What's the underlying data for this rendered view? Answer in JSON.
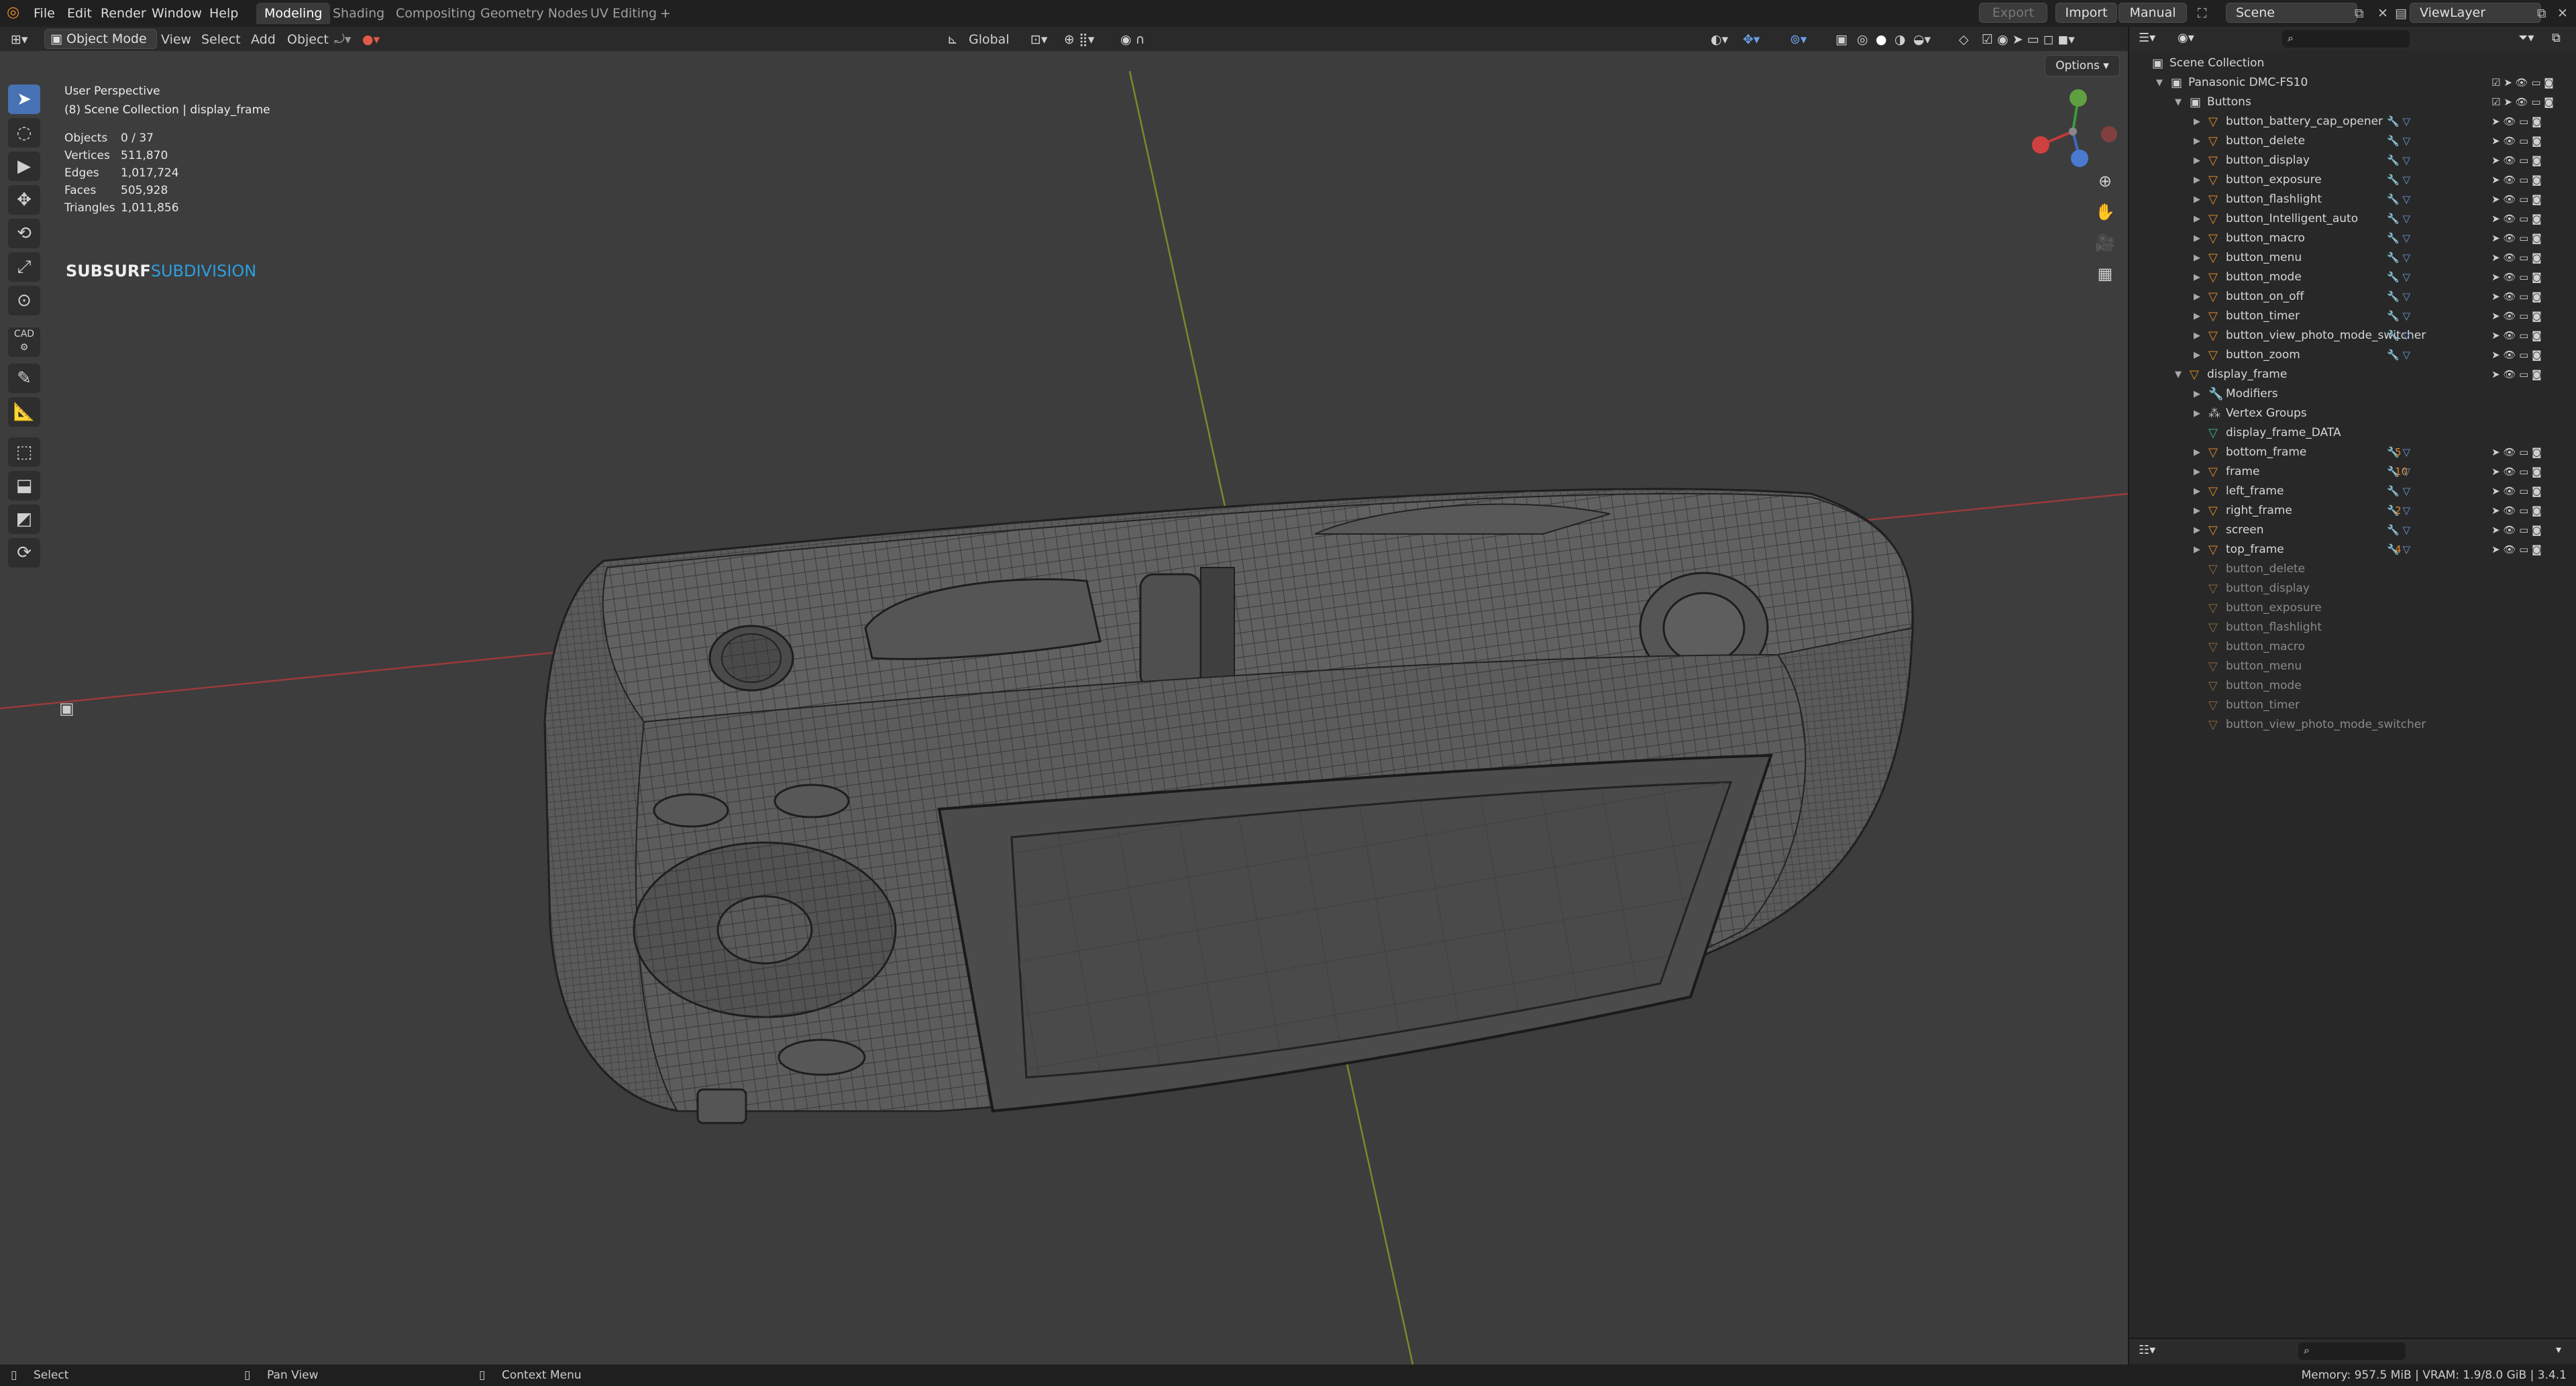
{
  "menu": {
    "items": [
      "File",
      "Edit",
      "Render",
      "Window",
      "Help"
    ],
    "workspaces": [
      "Modeling",
      "Shading",
      "Compositing",
      "Geometry Nodes",
      "UV Editing"
    ],
    "add_tab": "+",
    "export_label": "Export",
    "import_label": "Import",
    "manual_label": "Manual",
    "scene_label": "Scene",
    "viewlayer_label": "ViewLayer"
  },
  "viewport_header": {
    "mode": "Object Mode",
    "menus": [
      "View",
      "Select",
      "Add",
      "Object"
    ],
    "orientation": "Global",
    "options": "Options"
  },
  "overlay": {
    "perspective": "User Perspective",
    "collection": "(8) Scene Collection | display_frame",
    "stats": [
      {
        "label": "Objects",
        "value": "0 / 37"
      },
      {
        "label": "Vertices",
        "value": "511,870"
      },
      {
        "label": "Edges",
        "value": "1,017,724"
      },
      {
        "label": "Faces",
        "value": "505,928"
      },
      {
        "label": "Triangles",
        "value": "1,011,856"
      }
    ],
    "subsurf_a": "SUBSURF",
    "subsurf_b": "SUBDIVISION",
    "subsurf_b_color": "#2d9fe0"
  },
  "tools": [
    "cursor-select",
    "cursor",
    "move",
    "move-arrows",
    "rotate",
    "scale",
    "transform",
    "annotate",
    "measure",
    "add-cube",
    "extrude",
    "shear",
    "transform-alt"
  ],
  "tools_cad_label": "CAD",
  "outliner": {
    "root": "Scene Collection",
    "collection": "Panasonic DMC-FS10",
    "buttons_collection": "Buttons",
    "buttons": [
      "button_battery_cap_opener",
      "button_delete",
      "button_display",
      "button_exposure",
      "button_flashlight",
      "button_Intelligent_auto",
      "button_macro",
      "button_menu",
      "button_mode",
      "button_on_off",
      "button_timer",
      "button_view_photo_mode_switcher",
      "button_zoom"
    ],
    "display_frame": "display_frame",
    "display_children": [
      "Modifiers",
      "Vertex Groups",
      "display_frame_DATA",
      "bottom_frame",
      "frame",
      "left_frame",
      "right_frame",
      "screen",
      "top_frame"
    ],
    "child_counts": {
      "bottom_frame": "5",
      "frame": "10",
      "right_frame": "2",
      "top_frame": "4"
    },
    "ghost_items": [
      "button_delete",
      "button_display",
      "button_exposure",
      "button_flashlight",
      "button_macro",
      "button_menu",
      "button_mode",
      "button_timer",
      "button_view_photo_mode_switcher"
    ]
  },
  "status": {
    "select": "Select",
    "pan": "Pan View",
    "context": "Context Menu",
    "memory": "Memory: 957.5 MiB | VRAM: 1.9/8.0 GiB | 3.4.1"
  },
  "colors": {
    "accent": "#4772b3",
    "object_orange": "#e08a2c",
    "mesh_green": "#3fb58a",
    "axis_red": "#c23a3a",
    "axis_green": "#8a9a2a"
  }
}
